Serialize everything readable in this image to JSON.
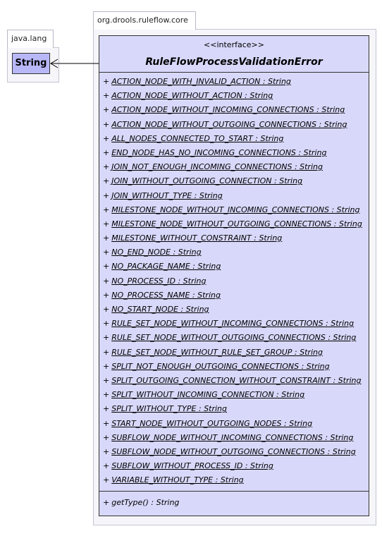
{
  "packages": {
    "java_lang": {
      "name": "java.lang"
    },
    "ruleflow_core": {
      "name": "org.drools.ruleflow.core"
    }
  },
  "string_class": {
    "name": "String"
  },
  "interface": {
    "stereotype": "<<interface>>",
    "name": "RuleFlowProcessValidationError",
    "attributes": [
      {
        "visibility": "+",
        "text": "ACTION_NODE_WITH_INVALID_ACTION : String"
      },
      {
        "visibility": "+",
        "text": "ACTION_NODE_WITHOUT_ACTION : String"
      },
      {
        "visibility": "+",
        "text": "ACTION_NODE_WITHOUT_INCOMING_CONNECTIONS : String"
      },
      {
        "visibility": "+",
        "text": "ACTION_NODE_WITHOUT_OUTGOING_CONNECTIONS : String"
      },
      {
        "visibility": "+",
        "text": "ALL_NODES_CONNECTED_TO_START : String"
      },
      {
        "visibility": "+",
        "text": "END_NODE_HAS_NO_INCOMING_CONNECTIONS : String"
      },
      {
        "visibility": "+",
        "text": "JOIN_NOT_ENOUGH_INCOMING_CONNECTIONS : String"
      },
      {
        "visibility": "+",
        "text": "JOIN_WITHOUT_OUTGOING_CONNECTION : String"
      },
      {
        "visibility": "+",
        "text": "JOIN_WITHOUT_TYPE : String"
      },
      {
        "visibility": "+",
        "text": "MILESTONE_NODE_WITHOUT_INCOMING_CONNECTIONS : String"
      },
      {
        "visibility": "+",
        "text": "MILESTONE_NODE_WITHOUT_OUTGOING_CONNECTIONS : String"
      },
      {
        "visibility": "+",
        "text": "MILESTONE_WITHOUT_CONSTRAINT : String"
      },
      {
        "visibility": "+",
        "text": "NO_END_NODE : String"
      },
      {
        "visibility": "+",
        "text": "NO_PACKAGE_NAME : String"
      },
      {
        "visibility": "+",
        "text": "NO_PROCESS_ID : String"
      },
      {
        "visibility": "+",
        "text": "NO_PROCESS_NAME : String"
      },
      {
        "visibility": "+",
        "text": "NO_START_NODE : String"
      },
      {
        "visibility": "+",
        "text": "RULE_SET_NODE_WITHOUT_INCOMING_CONNECTIONS : String"
      },
      {
        "visibility": "+",
        "text": "RULE_SET_NODE_WITHOUT_OUTGOING_CONNECTIONS : String"
      },
      {
        "visibility": "+",
        "text": "RULE_SET_NODE_WITHOUT_RULE_SET_GROUP : String"
      },
      {
        "visibility": "+",
        "text": "SPLIT_NOT_ENOUGH_OUTGOING_CONNECTIONS : String"
      },
      {
        "visibility": "+",
        "text": "SPLIT_OUTGOING_CONNECTION_WITHOUT_CONSTRAINT : String"
      },
      {
        "visibility": "+",
        "text": "SPLIT_WITHOUT_INCOMING_CONNECTION : String"
      },
      {
        "visibility": "+",
        "text": "SPLIT_WITHOUT_TYPE : String"
      },
      {
        "visibility": "+",
        "text": "START_NODE_WITHOUT_OUTGOING_NODES : String"
      },
      {
        "visibility": "+",
        "text": "SUBFLOW_NODE_WITHOUT_INCOMING_CONNECTIONS : String"
      },
      {
        "visibility": "+",
        "text": "SUBFLOW_NODE_WITHOUT_OUTGOING_CONNECTIONS : String"
      },
      {
        "visibility": "+",
        "text": "SUBFLOW_WITHOUT_PROCESS_ID : String"
      },
      {
        "visibility": "+",
        "text": "VARIABLE_WITHOUT_TYPE : String"
      }
    ],
    "methods": [
      {
        "visibility": "+",
        "text": "getType() : String"
      }
    ]
  },
  "colors": {
    "class_fill": "#d8d8fa",
    "string_fill": "#b8b8f8",
    "package_border": "#b8b8c8"
  }
}
